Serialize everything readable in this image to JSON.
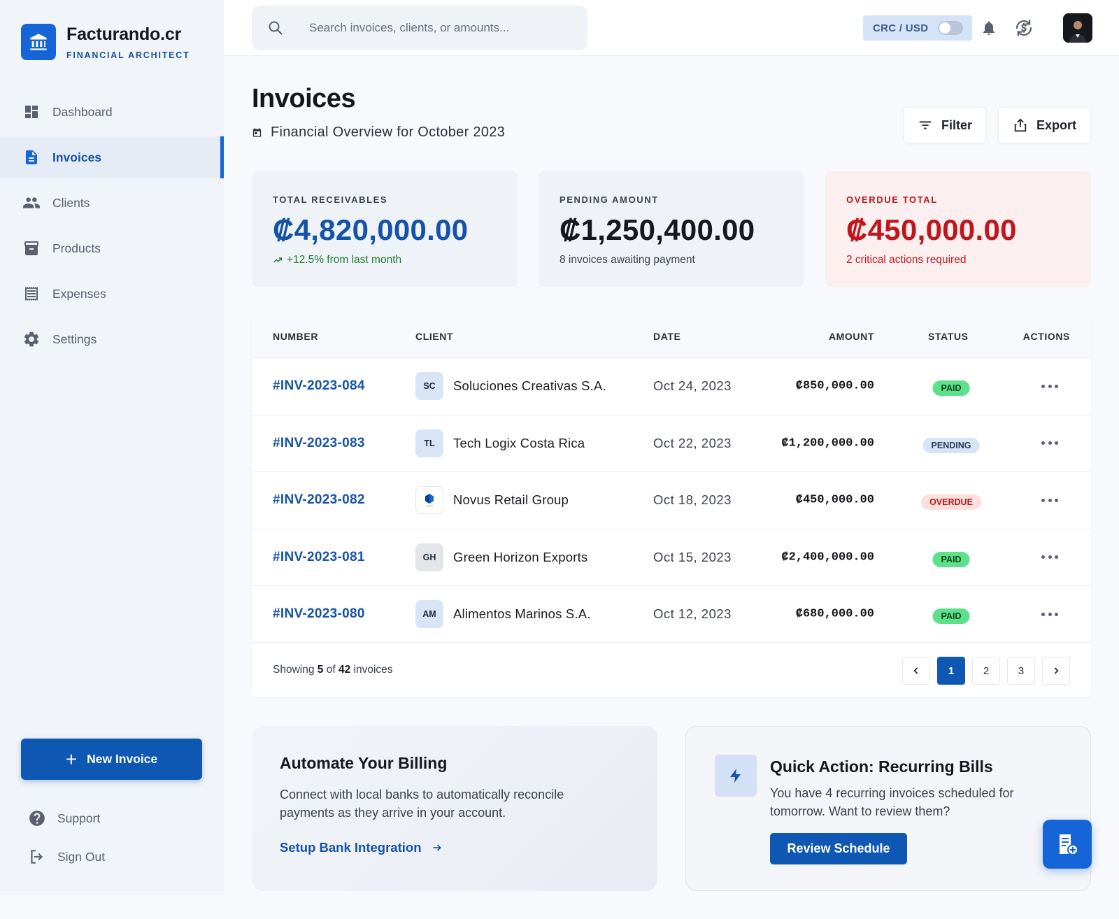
{
  "brand": {
    "name": "Facturando.cr",
    "tagline": "FINANCIAL ARCHITECT",
    "logo_icon": "bank-icon"
  },
  "sidebar": {
    "items": [
      {
        "label": "Dashboard",
        "icon": "dashboard-icon",
        "active": false
      },
      {
        "label": "Invoices",
        "icon": "invoice-icon",
        "active": true
      },
      {
        "label": "Clients",
        "icon": "people-icon",
        "active": false
      },
      {
        "label": "Products",
        "icon": "archive-icon",
        "active": false
      },
      {
        "label": "Expenses",
        "icon": "receipt-icon",
        "active": false
      },
      {
        "label": "Settings",
        "icon": "gear-icon",
        "active": false
      }
    ],
    "new_invoice_label": "New Invoice",
    "support_label": "Support",
    "signout_label": "Sign Out"
  },
  "topbar": {
    "search_placeholder": "Search invoices, clients, or amounts...",
    "currency_label": "CRC / USD",
    "currency_toggle_on": false
  },
  "header": {
    "title": "Invoices",
    "subtitle": "Financial Overview for October 2023",
    "filter_label": "Filter",
    "export_label": "Export"
  },
  "stats": {
    "receivables": {
      "label": "TOTAL RECEIVABLES",
      "value": "₡4,820,000.00",
      "note": "+12.5% from last month"
    },
    "pending": {
      "label": "PENDING AMOUNT",
      "value": "₡1,250,400.00",
      "note": "8 invoices awaiting payment"
    },
    "overdue": {
      "label": "OVERDUE TOTAL",
      "value": "₡450,000.00",
      "note": "2 critical actions required"
    }
  },
  "table": {
    "headers": {
      "number": "NUMBER",
      "client": "CLIENT",
      "date": "DATE",
      "amount": "AMOUNT",
      "status": "STATUS",
      "actions": "ACTIONS"
    },
    "rows": [
      {
        "number": "#INV-2023-084",
        "initials": "SC",
        "client": "Soluciones Creativas S.A.",
        "date": "Oct 24, 2023",
        "amount": "₡850,000.00",
        "status": "PAID"
      },
      {
        "number": "#INV-2023-083",
        "initials": "TL",
        "client": "Tech Logix Costa Rica",
        "date": "Oct 22, 2023",
        "amount": "₡1,200,000.00",
        "status": "PENDING"
      },
      {
        "number": "#INV-2023-082",
        "initials": "",
        "client": "Novus Retail Group",
        "date": "Oct 18, 2023",
        "amount": "₡450,000.00",
        "status": "OVERDUE"
      },
      {
        "number": "#INV-2023-081",
        "initials": "GH",
        "client": "Green Horizon Exports",
        "date": "Oct 15, 2023",
        "amount": "₡2,400,000.00",
        "status": "PAID"
      },
      {
        "number": "#INV-2023-080",
        "initials": "AM",
        "client": "Alimentos Marinos S.A.",
        "date": "Oct 12, 2023",
        "amount": "₡680,000.00",
        "status": "PAID"
      }
    ],
    "footer": {
      "showing_prefix": "Showing",
      "shown": "5",
      "of_word": "of",
      "total": "42",
      "suffix": "invoices"
    },
    "pages": [
      "1",
      "2",
      "3"
    ],
    "current_page": "1"
  },
  "promo": {
    "title": "Automate Your Billing",
    "text": "Connect with local banks to automatically reconcile payments as they arrive in your account.",
    "link_label": "Setup Bank Integration"
  },
  "quick_action": {
    "title": "Quick Action: Recurring Bills",
    "text": "You have 4 recurring invoices scheduled for tomorrow. Want to review them?",
    "button_label": "Review Schedule"
  },
  "colors": {
    "brand_blue": "#1565d8",
    "primary_dark": "#0e57b3",
    "link_blue": "#1553a8",
    "overdue_red": "#c0161b",
    "paid_green": "#5de08a"
  }
}
